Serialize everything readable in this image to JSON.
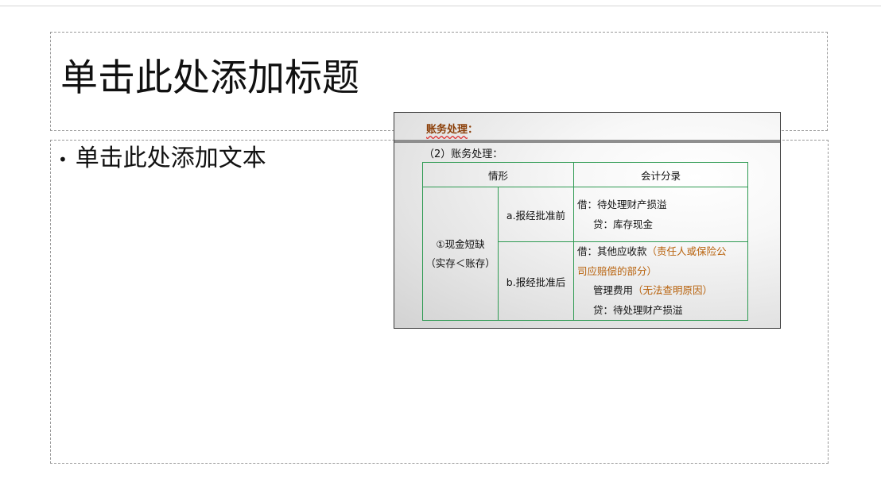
{
  "slide": {
    "title_placeholder": "单击此处添加标题",
    "body_bullet_placeholder": "单击此处添加文本",
    "bullet_char": "•"
  },
  "picture": {
    "heading": "账务处理",
    "heading_colon": "：",
    "subtitle": "（2）账务处理：",
    "table": {
      "headers": [
        "情形",
        "会计分录"
      ],
      "group_label_line1": "①现金短缺",
      "group_label_line2": "（实存＜账存）",
      "rows": [
        {
          "case": "a.报经批准前",
          "entry": {
            "line1": "借：待处理财产损溢",
            "line2": "贷：库存现金"
          }
        },
        {
          "case": "b.报经批准后",
          "entry": {
            "line1_a": "借：其他应收款",
            "line1_b": "（责任人或保险公",
            "line1_c": "司应赔偿的部分）",
            "line2_a": "管理费用",
            "line2_b": "（无法查明原因）",
            "line3": "贷：待处理财产损溢"
          }
        }
      ]
    },
    "colors": {
      "heading": "#8a3d06",
      "highlight": "#b8620c",
      "table_border": "#2e9a52"
    }
  }
}
